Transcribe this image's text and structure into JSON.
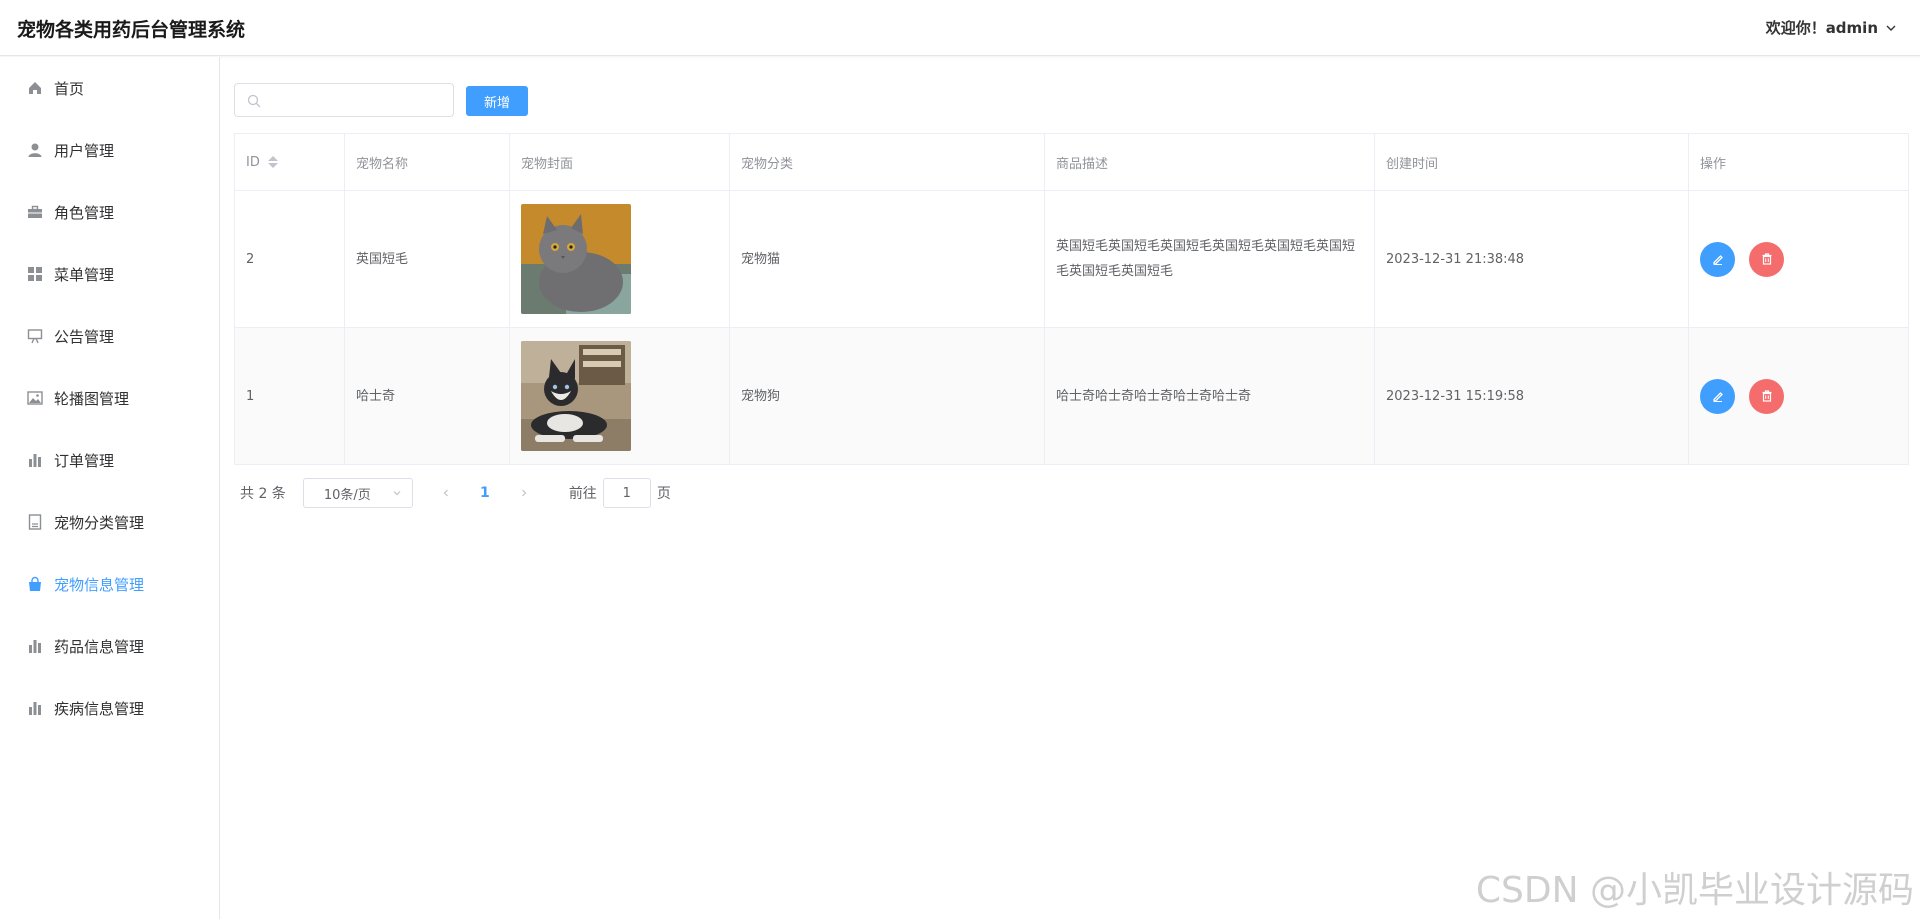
{
  "app": {
    "title": "宠物各类用药后台管理系统"
  },
  "user": {
    "greeting": "欢迎你！admin"
  },
  "sidebar": {
    "items": [
      {
        "label": "首页",
        "icon": "house-icon"
      },
      {
        "label": "用户管理",
        "icon": "user-icon"
      },
      {
        "label": "角色管理",
        "icon": "briefcase-icon"
      },
      {
        "label": "菜单管理",
        "icon": "grid-icon"
      },
      {
        "label": "公告管理",
        "icon": "easel-icon"
      },
      {
        "label": "轮播图管理",
        "icon": "picture-icon"
      },
      {
        "label": "订单管理",
        "icon": "bar-chart-icon"
      },
      {
        "label": "宠物分类管理",
        "icon": "document-icon"
      },
      {
        "label": "宠物信息管理",
        "icon": "shopping-bag-icon",
        "active": true
      },
      {
        "label": "药品信息管理",
        "icon": "bar-chart-icon"
      },
      {
        "label": "疾病信息管理",
        "icon": "bar-chart-icon"
      }
    ],
    "active_color": "#409eff"
  },
  "toolbar": {
    "search_placeholder": "",
    "search_value": "",
    "add_label": "新增"
  },
  "table": {
    "headers": [
      "ID",
      "宠物名称",
      "宠物封面",
      "宠物分类",
      "商品描述",
      "创建时间",
      "操作"
    ],
    "rows": [
      {
        "id": "2",
        "name": "英国短毛",
        "cover": "cat-photo",
        "category": "宠物猫",
        "description": "英国短毛英国短毛英国短毛英国短毛英国短毛英国短毛英国短毛英国短毛",
        "created": "2023-12-31 21:38:48"
      },
      {
        "id": "1",
        "name": "哈士奇",
        "cover": "husky-photo",
        "category": "宠物狗",
        "description": "哈士奇哈士奇哈士奇哈士奇哈士奇",
        "created": "2023-12-31 15:19:58"
      }
    ]
  },
  "pagination": {
    "total_label": "共 2 条",
    "page_size": "10条/页",
    "current_page": "1",
    "goto_label": "前往",
    "goto_value": "1",
    "page_suffix": "页"
  },
  "watermark": "CSDN @小凯毕业设计源码",
  "colors": {
    "primary": "#409eff",
    "danger": "#f56c6c",
    "border": "#ebeef5"
  }
}
